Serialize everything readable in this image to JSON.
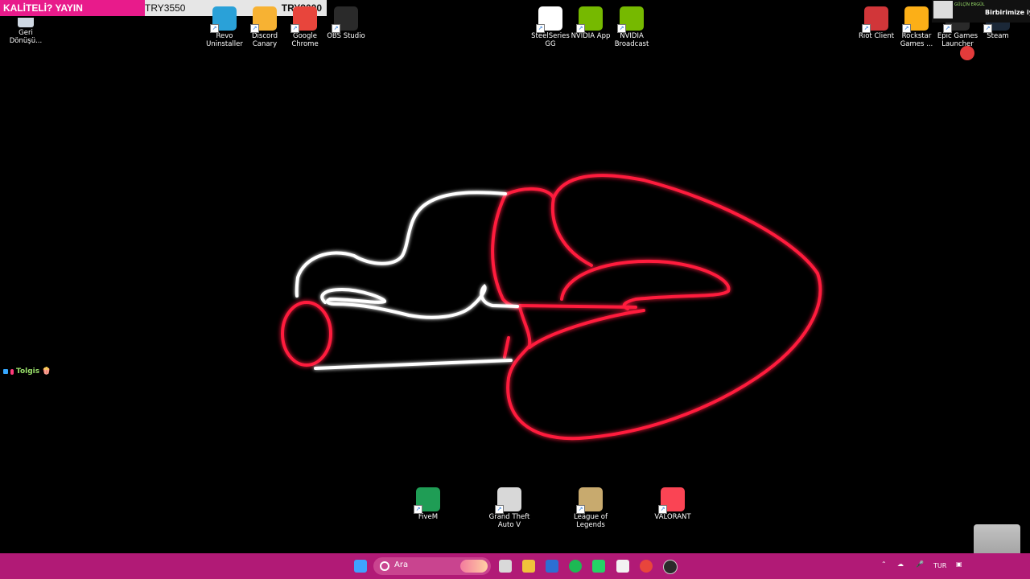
{
  "overlay": {
    "left_text": "KALİTELİ? YAYIN",
    "price_left": "TRY3550",
    "price_right": "TRY8000"
  },
  "desktop_icons_top_left": [
    {
      "label": "Geri\nDönüşü..."
    }
  ],
  "desktop_icons_top": [
    {
      "label": "Revo\nUninstaller",
      "color": "#2aa1d8"
    },
    {
      "label": "Discord\nCanary",
      "color": "#f7b233"
    },
    {
      "label": "Google\nChrome",
      "color": "#e8453c"
    },
    {
      "label": "OBS Studio",
      "color": "#2a2a2a"
    },
    {
      "label": "SteelSeries\nGG",
      "color": "#ffffff"
    },
    {
      "label": "NVIDIA App",
      "color": "#76b900"
    },
    {
      "label": "NVIDIA\nBroadcast",
      "color": "#76b900"
    },
    {
      "label": "Riot Client",
      "color": "#d13639"
    },
    {
      "label": "Rockstar\nGames ...",
      "color": "#fcaf17"
    },
    {
      "label": "Epic Games\nLauncher",
      "color": "#2a2a2a"
    },
    {
      "label": "Steam",
      "color": "#1b2838"
    }
  ],
  "desktop_icons_bottom": [
    {
      "label": "FiveM",
      "color": "#1f9d55"
    },
    {
      "label": "Grand Theft\nAuto V",
      "color": "#d8d8d8"
    },
    {
      "label": "League of\nLegends",
      "color": "#c8aa6e"
    },
    {
      "label": "VALORANT",
      "color": "#fa4454"
    }
  ],
  "chat": {
    "user": "Tolgis"
  },
  "webcam": {
    "name": "GÜLÇİN ERGÜL",
    "message": "Birbirimize iyi"
  },
  "taskbar": {
    "search_placeholder": "Ara",
    "language": "TUR"
  }
}
